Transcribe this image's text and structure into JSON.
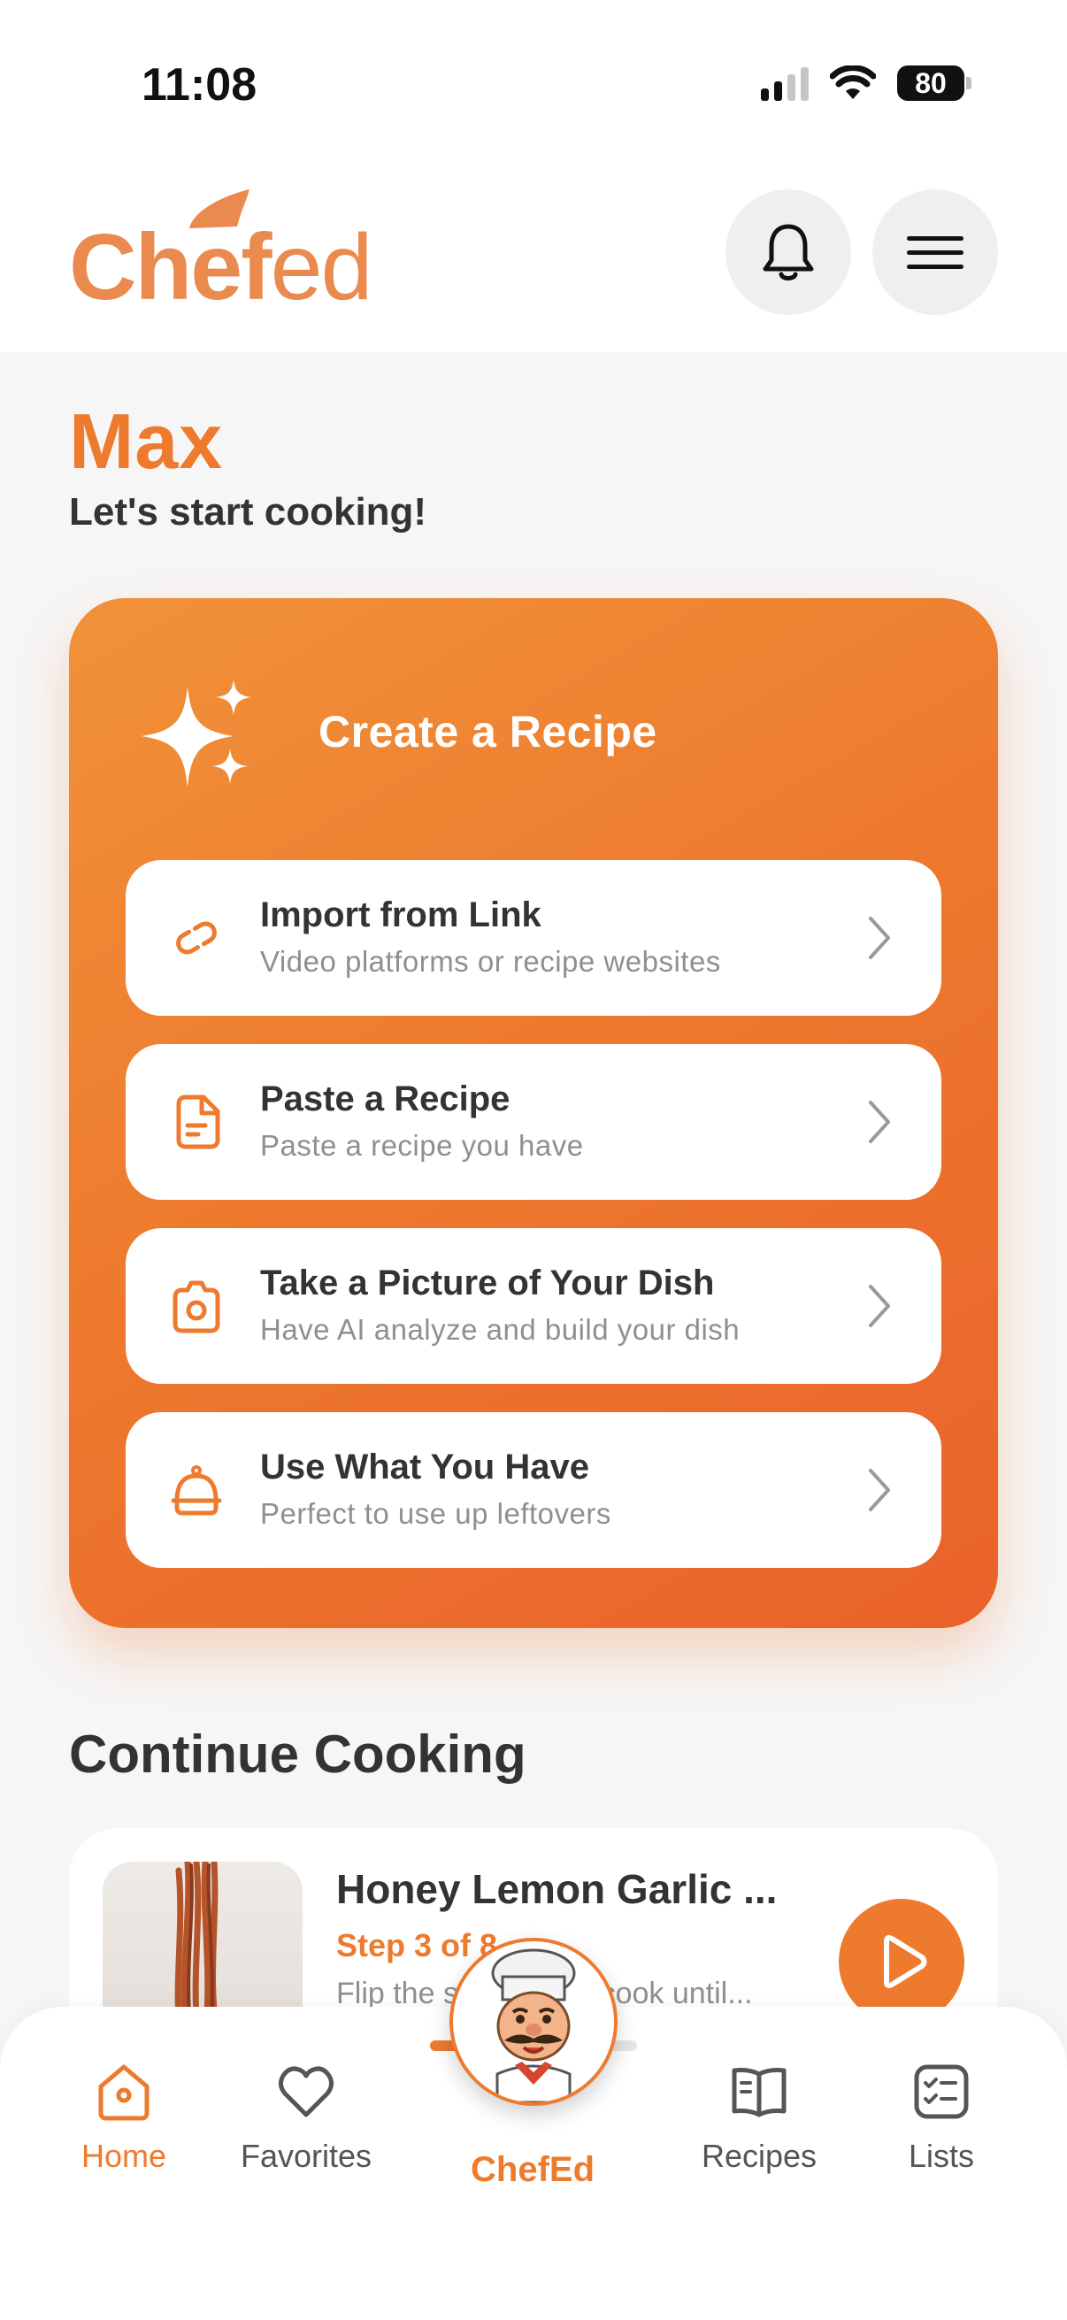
{
  "status_bar": {
    "time": "11:08",
    "battery": "80",
    "signal_bars": 2
  },
  "header": {
    "logo_text_bold": "Chef",
    "logo_text_light": "ed",
    "bell_icon": "bell-icon",
    "menu_icon": "hamburger-menu-icon"
  },
  "greeting": {
    "name": "Max",
    "subtitle": "Let's start cooking!"
  },
  "create_recipe": {
    "title": "Create a Recipe",
    "icon": "sparkle-icon",
    "options": [
      {
        "title": "Import from Link",
        "subtitle": "Video platforms or recipe websites",
        "icon": "link-icon"
      },
      {
        "title": "Paste a Recipe",
        "subtitle": "Paste a recipe you have",
        "icon": "document-icon"
      },
      {
        "title": "Take a Picture of Your Dish",
        "subtitle": "Have AI analyze and build your dish",
        "icon": "camera-icon"
      },
      {
        "title": "Use What You Have",
        "subtitle": "Perfect to use up leftovers",
        "icon": "cloche-icon"
      }
    ]
  },
  "continue_cooking": {
    "title": "Continue Cooking",
    "recipe": {
      "name": "Honey Lemon Garlic ...",
      "step": "Step 3 of 8",
      "description": "Flip the shrimp and cook until..."
    }
  },
  "tab_bar": {
    "tabs": [
      {
        "label": "Home",
        "icon": "home-icon",
        "active": true
      },
      {
        "label": "Favorites",
        "icon": "heart-icon",
        "active": false
      },
      {
        "label": "ChefEd",
        "icon": "chef-avatar",
        "active": false
      },
      {
        "label": "Recipes",
        "icon": "book-icon",
        "active": false
      },
      {
        "label": "Lists",
        "icon": "checklist-icon",
        "active": false
      }
    ],
    "chef_progress": 0.3
  },
  "colors": {
    "accent": "#ee7a2e",
    "background": "#f6f6f6",
    "text": "#333333",
    "muted": "#8f8f8f"
  }
}
